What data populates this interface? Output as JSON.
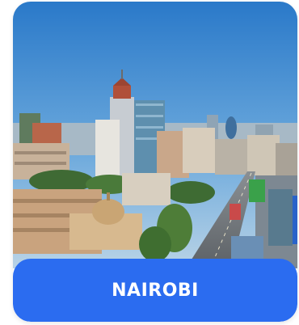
{
  "card": {
    "title": "NAIROBI",
    "image_subject": "city-skyline-photo",
    "accent_color": "#2b6cf0"
  }
}
